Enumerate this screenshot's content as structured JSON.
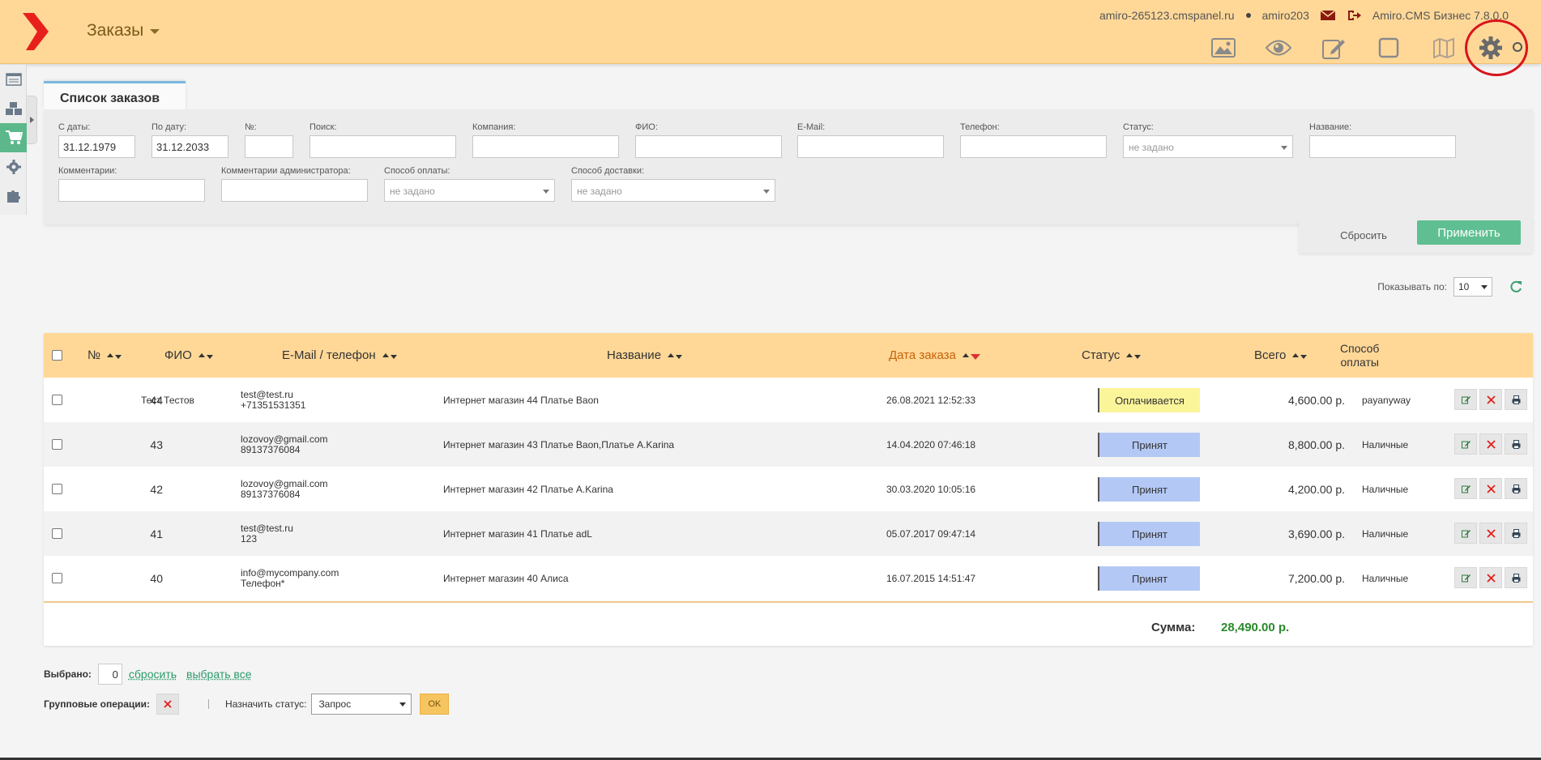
{
  "header": {
    "module_title": "Заказы",
    "domain": "amiro-265123.cmspanel.ru",
    "user": "amiro203",
    "product": "Amiro.CMS Бизнес 7.8.0.0",
    "brand_color": "#e8201c",
    "toolbar_icons": [
      "image-icon",
      "eye-icon",
      "edit-icon",
      "square-icon",
      "map-icon",
      "gear-icon",
      "search-icon"
    ]
  },
  "sidebar": {
    "items": [
      "list-icon",
      "boxes-icon",
      "cart-icon",
      "gear-icon",
      "puzzle-icon"
    ],
    "active_index": 2
  },
  "filter": {
    "tab_title": "Список заказов",
    "date_from_label": "С даты:",
    "date_from_value": "31.12.1979",
    "date_to_label": "По дату:",
    "date_to_value": "31.12.2033",
    "number_label": "№:",
    "search_label": "Поиск:",
    "company_label": "Компания:",
    "fio_label": "ФИО:",
    "email_label": "E-Mail:",
    "phone_label": "Телефон:",
    "status_label": "Статус:",
    "status_value": "не задано",
    "name_label": "Название:",
    "comments_label": "Комментарии:",
    "admin_comments_label": "Комментарии администратора:",
    "payment_label": "Способ оплаты:",
    "payment_value": "не задано",
    "delivery_label": "Способ доставки:",
    "delivery_value": "не задано",
    "reset_label": "Сбросить",
    "apply_label": "Применить"
  },
  "paging": {
    "label": "Показывать по:",
    "value": "10"
  },
  "table": {
    "columns": {
      "number": "№",
      "fio": "ФИО",
      "email": "E-Mail / телефон",
      "name": "Название",
      "date": "Дата заказа",
      "status": "Статус",
      "total": "Всего",
      "payment_line1": "Способ",
      "payment_line2": "оплаты"
    },
    "rows": [
      {
        "id": "44",
        "fio": "Тест Тестов",
        "email": "test@test.ru",
        "phone": "+71351531351",
        "name": "Интернет магазин 44 Платье Baon",
        "date": "26.08.2021 12:52:33",
        "status": "Оплачивается",
        "total": "4,600.00 р.",
        "payment": "payanyway"
      },
      {
        "id": "43",
        "fio": "",
        "email": "lozovoy@gmail.com",
        "phone": "89137376084",
        "name": "Интернет магазин 43 Платье Baon,Платье A.Karina",
        "date": "14.04.2020 07:46:18",
        "status": "Принят",
        "total": "8,800.00 р.",
        "payment": "Наличные"
      },
      {
        "id": "42",
        "fio": "",
        "email": "lozovoy@gmail.com",
        "phone": "89137376084",
        "name": "Интернет магазин 42 Платье A.Karina",
        "date": "30.03.2020 10:05:16",
        "status": "Принят",
        "total": "4,200.00 р.",
        "payment": "Наличные"
      },
      {
        "id": "41",
        "fio": "",
        "email": "test@test.ru",
        "phone": "123",
        "name": "Интернет магазин 41 Платье adL",
        "date": "05.07.2017 09:47:14",
        "status": "Принят",
        "total": "3,690.00 р.",
        "payment": "Наличные"
      },
      {
        "id": "40",
        "fio": "",
        "email": "info@mycompany.com",
        "phone": "Телефон*",
        "name": "Интернет магазин 40 Алиса",
        "date": "16.07.2015 14:51:47",
        "status": "Принят",
        "total": "7,200.00 р.",
        "payment": "Наличные"
      }
    ],
    "status_colors": {
      "Оплачивается": "#fbf59a",
      "Принят": "#b4c8f6"
    },
    "sum_label": "Сумма:",
    "sum_value": "28,490.00 р."
  },
  "bottom": {
    "selected_label": "Выбрано:",
    "selected_count": "0",
    "reset_link": "сбросить",
    "select_all_link": "выбрать все",
    "group_ops_label": "Групповые операции:",
    "assign_status_label": "Назначить статус:",
    "assign_status_value": "Запрос",
    "ok_label": "OK"
  }
}
